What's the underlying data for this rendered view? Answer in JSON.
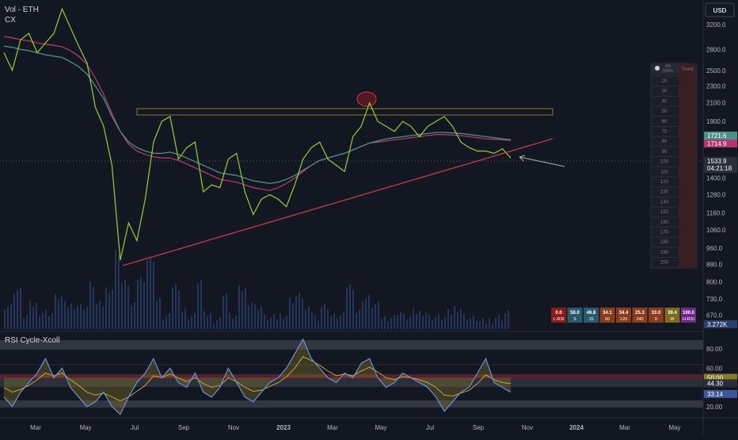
{
  "header": {
    "symbol_label": "Vol - ETH",
    "sub_label": "CX"
  },
  "currency_button": "USD",
  "colors": {
    "background": "#131722",
    "price_line": "#9acd32",
    "ma_teal": "#4e8f8a",
    "ma_pink": "#b0386e",
    "trend_line": "#c23b4a",
    "rsi_line": "#6b8fd6",
    "rsi_signal": "#c8a23a",
    "volume": "#2a3f6b"
  },
  "chart_data": [
    {
      "type": "line",
      "title": "",
      "x_ticks": [
        "Mar",
        "May",
        "Jul",
        "Sep",
        "Nov",
        "2023",
        "Mar",
        "May",
        "Jul",
        "Sep",
        "Nov",
        "2024",
        "Mar",
        "May"
      ],
      "y_ticks": [
        3200,
        2800,
        2500,
        2300,
        2100,
        1900,
        1400,
        1280,
        1160,
        1060,
        960,
        880,
        800,
        730,
        670
      ],
      "y_scale": "log",
      "ylim": [
        640,
        3500
      ],
      "price_labels": [
        {
          "text": "1721.6",
          "color": "#4e8f8a"
        },
        {
          "text": "1714.9",
          "color": "#b0386e"
        },
        {
          "text": "1533.9",
          "sub": "04:21:18",
          "color": "#2a2e39"
        }
      ],
      "volume_label": "3.272K",
      "series": [
        {
          "values": [
            2750,
            2500,
            2950,
            3050,
            2750,
            2900,
            3050,
            3480,
            3150,
            2850,
            2600,
            2050,
            1850,
            1500,
            900,
            1100,
            1000,
            1250,
            1700,
            1900,
            1950,
            1550,
            1650,
            1700,
            1300,
            1350,
            1330,
            1550,
            1600,
            1300,
            1150,
            1250,
            1280,
            1250,
            1200,
            1350,
            1550,
            1650,
            1700,
            1550,
            1500,
            1450,
            1750,
            1850,
            2100,
            1900,
            1850,
            1800,
            1900,
            1850,
            1750,
            1850,
            1900,
            1950,
            1850,
            1700,
            1650,
            1620,
            1620,
            1600,
            1640,
            1560
          ]
        },
        {
          "values": [
            2850,
            2830,
            2800,
            2780,
            2750,
            2720,
            2700,
            2680,
            2620,
            2550,
            2450,
            2300,
            2150,
            1950,
            1800,
            1700,
            1650,
            1620,
            1600,
            1600,
            1610,
            1590,
            1560,
            1530,
            1500,
            1470,
            1440,
            1430,
            1420,
            1400,
            1380,
            1370,
            1360,
            1370,
            1390,
            1420,
            1460,
            1500,
            1540,
            1560,
            1580,
            1600,
            1630,
            1660,
            1690,
            1710,
            1730,
            1740,
            1750,
            1760,
            1770,
            1780,
            1790,
            1790,
            1785,
            1780,
            1770,
            1760,
            1750,
            1740,
            1730,
            1722
          ]
        },
        {
          "values": [
            3000,
            2980,
            2950,
            2930,
            2900,
            2880,
            2860,
            2840,
            2780,
            2700,
            2580,
            2400,
            2200,
            1980,
            1800,
            1680,
            1620,
            1590,
            1570,
            1560,
            1560,
            1540,
            1510,
            1480,
            1450,
            1420,
            1390,
            1380,
            1370,
            1350,
            1330,
            1320,
            1310,
            1330,
            1360,
            1400,
            1450,
            1500,
            1540,
            1560,
            1580,
            1600,
            1630,
            1660,
            1690,
            1700,
            1710,
            1720,
            1730,
            1740,
            1750,
            1760,
            1770,
            1770,
            1765,
            1760,
            1750,
            1740,
            1730,
            1725,
            1720,
            1715
          ]
        }
      ]
    },
    {
      "type": "line",
      "title": "RSI Cycle-Xcoll",
      "y_ticks": [
        80,
        60,
        20
      ],
      "ylim": [
        10,
        95
      ],
      "value_labels": [
        {
          "text": "50.00",
          "color": "#8a7a2a"
        },
        {
          "text": "44.30",
          "color": "#2a2e39"
        },
        {
          "text": "33.14",
          "color": "#3b5998"
        }
      ],
      "series": [
        {
          "values": [
            30,
            20,
            35,
            45,
            55,
            70,
            50,
            60,
            40,
            30,
            20,
            25,
            35,
            20,
            12,
            30,
            45,
            55,
            70,
            50,
            60,
            45,
            40,
            55,
            35,
            30,
            40,
            60,
            45,
            30,
            25,
            35,
            45,
            50,
            60,
            75,
            90,
            70,
            60,
            50,
            45,
            55,
            50,
            65,
            70,
            50,
            40,
            45,
            55,
            50,
            45,
            40,
            30,
            15,
            25,
            35,
            40,
            55,
            70,
            45,
            40,
            35
          ]
        },
        {
          "values": [
            40,
            35,
            38,
            42,
            48,
            55,
            52,
            55,
            48,
            42,
            35,
            32,
            34,
            30,
            26,
            30,
            36,
            42,
            52,
            50,
            54,
            50,
            46,
            50,
            44,
            40,
            42,
            50,
            46,
            40,
            36,
            37,
            41,
            45,
            51,
            60,
            72,
            68,
            63,
            57,
            52,
            54,
            52,
            57,
            61,
            56,
            50,
            48,
            51,
            50,
            48,
            45,
            40,
            32,
            31,
            34,
            37,
            44,
            53,
            48,
            45,
            44
          ]
        }
      ]
    }
  ],
  "mtf_table": {
    "values": [
      "0.0",
      "58.0",
      "46.8",
      "34.1",
      "34.4",
      "25.3",
      "33.0",
      "39.4",
      "100.0"
    ],
    "labels": [
      "L-RSI",
      "5",
      "15",
      "60",
      "120",
      "240",
      "D",
      "W",
      "H-RSI"
    ],
    "colors": [
      "#8b1a1a",
      "#2a5a6a",
      "#2a5a6a",
      "#8b3a1a",
      "#8b3a1a",
      "#8b3a1a",
      "#8b3a1a",
      "#7a6a1a",
      "#6a2a8a"
    ]
  },
  "scale_table": {
    "header_a": "0%",
    "header_b": "100%",
    "header_trend": "Trend",
    "rows": [
      "20",
      "30",
      "40",
      "50",
      "60",
      "70",
      "80",
      "90",
      "100",
      "110",
      "120",
      "130",
      "140",
      "150",
      "160",
      "170",
      "180",
      "190",
      "200"
    ]
  }
}
